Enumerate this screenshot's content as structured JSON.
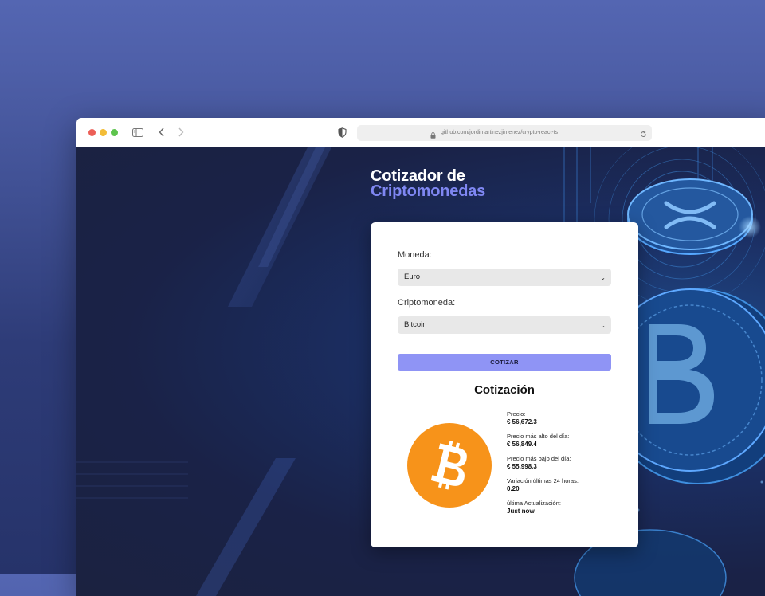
{
  "browser": {
    "url": "github.com/jordimartinezjimenez/crypto-react-ts"
  },
  "app": {
    "title_line1": "Cotizador de",
    "title_line2": "Criptomonedas"
  },
  "form": {
    "currency_label": "Moneda:",
    "currency_value": "Euro",
    "crypto_label": "Criptomoneda:",
    "crypto_value": "Bitcoin",
    "submit_label": "COTIZAR"
  },
  "result": {
    "title": "Cotización",
    "coin_icon": "bitcoin-logo",
    "stats": [
      {
        "label": "Precio:",
        "value": "€ 56,672.3"
      },
      {
        "label": "Precio más alto del día:",
        "value": "€ 56,849.4"
      },
      {
        "label": "Precio más bajo del día:",
        "value": "€ 55,998.3"
      },
      {
        "label": "Variación últimas 24 horas:",
        "value": "0.20"
      },
      {
        "label": "última Actualización:",
        "value": "Just now"
      }
    ]
  },
  "colors": {
    "accent": "#8f94f5",
    "title_highlight": "#7f87f2",
    "bitcoin": "#f7931a"
  }
}
